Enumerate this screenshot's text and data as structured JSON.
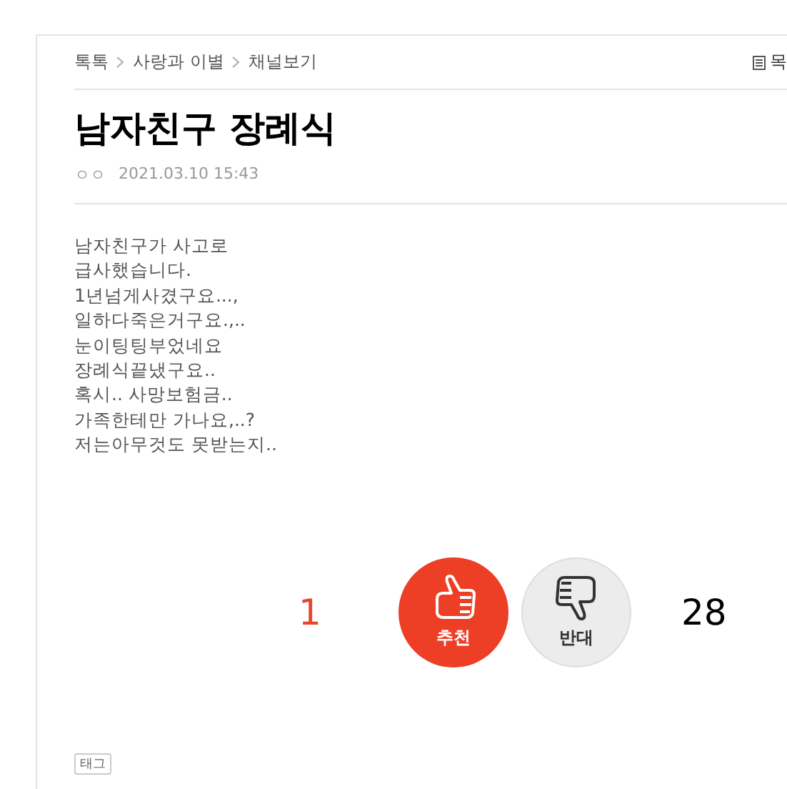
{
  "breadcrumb": [
    "톡톡",
    "사랑과 이별",
    "채널보기"
  ],
  "list_link": "목",
  "title": "남자친구 장례식",
  "author": "ㅇㅇ",
  "date": "2021.03.10 15:43",
  "body": [
    "남자친구가 사고로",
    "급사했습니다.",
    "1년넘게사겼구요...,",
    "일하다죽은거구요.,..",
    "눈이팅팅부었네요",
    "장례식끝냈구요..",
    "혹시.. 사망보험금..",
    "가족한테만 가나요,..?",
    "저는아무것도 못받는지.."
  ],
  "votes": [
    {
      "kind": "up",
      "count": "1",
      "label": "추천"
    },
    {
      "kind": "down",
      "count": "28",
      "label": "반대"
    }
  ],
  "tag_label": "태그"
}
